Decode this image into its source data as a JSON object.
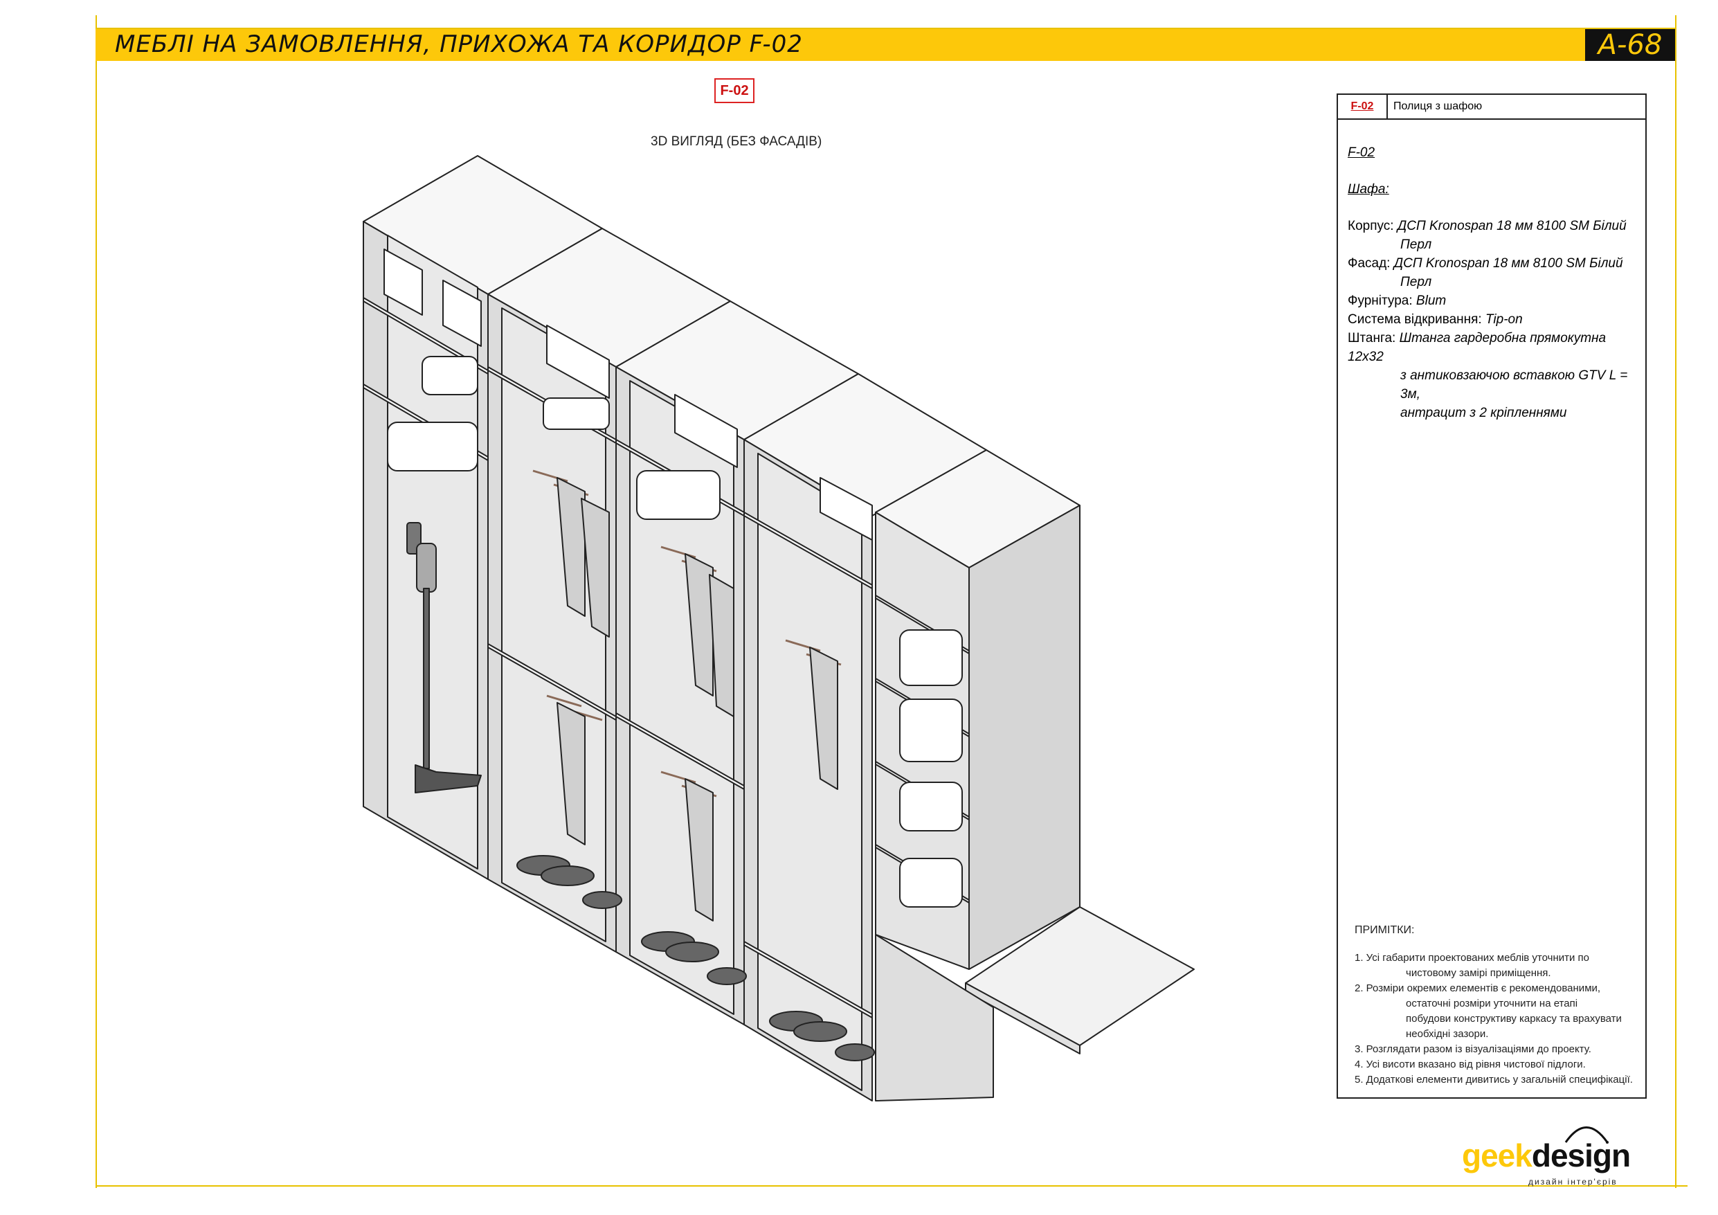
{
  "header": {
    "title": "МЕБЛІ НА ЗАМОВЛЕННЯ, ПРИХОЖА ТА КОРИДОР F-02",
    "sheet": "А-68"
  },
  "drawing": {
    "tag": "F-02",
    "view_label": "3D ВИГЛЯД (БЕЗ ФАСАДІВ)"
  },
  "spec": {
    "code": "F-02",
    "name": "Полиця з шафою",
    "item": "F-02",
    "section": "Шафа:",
    "rows": [
      {
        "label": "Корпус:",
        "value": "ДСП Kronospan 18 мм 8100 SM Білий",
        "cont": "Перл"
      },
      {
        "label": "Фасад:",
        "value": "ДСП Kronospan 18 мм 8100 SM Білий",
        "cont": "Перл"
      },
      {
        "label": "Фурнітура:",
        "value": "Blum"
      },
      {
        "label": "Система відкривання:",
        "value": "Tip-on"
      },
      {
        "label": "Штанга:",
        "value": "Штанга гардеробна прямокутна 12х32",
        "cont": "з антиковзаючою вставкою GTV L = 3м,",
        "cont2": "антрацит з 2 кріпленнями"
      }
    ]
  },
  "notes": {
    "title": "ПРИМІТКИ:",
    "items": [
      {
        "first": "1. Усі габарити проектованих меблів уточнити по",
        "rest": [
          "чистовому замірі приміщення."
        ]
      },
      {
        "first": "2. Розміри окремих елементів є рекомендованими,",
        "rest": [
          "остаточні розміри уточнити на етапі",
          "побудови конструктиву каркасу та врахувати",
          "необхідні зазори."
        ]
      },
      {
        "first": "3. Розглядати разом із візуалізаціями до проекту.",
        "rest": []
      },
      {
        "first": "4. Усі висоти вказано від рівня чистової підлоги.",
        "rest": []
      },
      {
        "first": "5. Додаткові елементи дивитись у загальній специфікації.",
        "rest": []
      }
    ]
  },
  "logo": {
    "part1": "geek",
    "part2": "design",
    "tagline": "дизайн інтер'єрів"
  },
  "colors": {
    "accent": "#fdc80a",
    "ink": "#111111",
    "tag_red": "#cc1111",
    "panel_gray": "#dcdcdc"
  }
}
